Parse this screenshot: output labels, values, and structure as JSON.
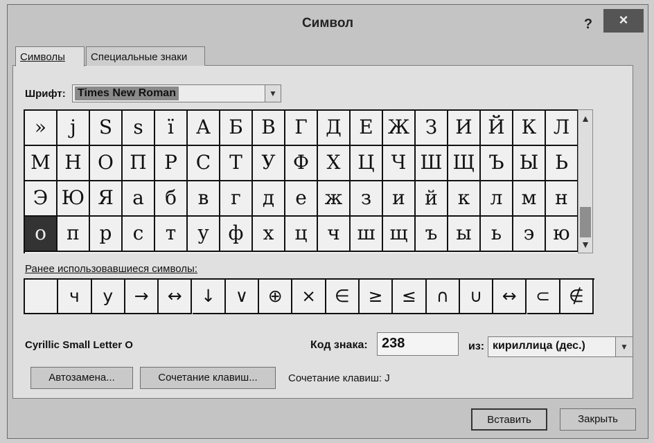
{
  "dialog": {
    "title": "Символ",
    "help_label": "?",
    "close_label": "×"
  },
  "tabs": [
    {
      "label": "Символы",
      "active": true
    },
    {
      "label": "Специальные знаки",
      "active": false
    }
  ],
  "font": {
    "label": "Шрифт:",
    "value": "Times New Roman"
  },
  "symbol_grid": {
    "rows": [
      [
        "»",
        "j",
        "S",
        "s",
        "ï",
        "А",
        "Б",
        "В",
        "Г",
        "Д",
        "Е",
        "Ж",
        "З",
        "И",
        "Й",
        "К",
        "Л"
      ],
      [
        "М",
        "Н",
        "О",
        "П",
        "Р",
        "С",
        "Т",
        "У",
        "Ф",
        "Х",
        "Ц",
        "Ч",
        "Ш",
        "Щ",
        "Ъ",
        "Ы",
        "Ь"
      ],
      [
        "Э",
        "Ю",
        "Я",
        "а",
        "б",
        "в",
        "г",
        "д",
        "е",
        "ж",
        "з",
        "и",
        "й",
        "к",
        "л",
        "м",
        "н"
      ],
      [
        "о",
        "п",
        "р",
        "с",
        "т",
        "у",
        "ф",
        "х",
        "ц",
        "ч",
        "ш",
        "щ",
        "ъ",
        "ы",
        "ь",
        "э",
        "ю"
      ]
    ],
    "selected_row": 3,
    "selected_col": 0
  },
  "recent": {
    "label": "Ранее использовавшиеся символы:",
    "symbols": [
      "",
      "ч",
      "у",
      "→",
      "↔",
      "↓",
      "∨",
      "⊕",
      "×",
      "∈",
      "≥",
      "≤",
      "∩",
      "∪",
      "↔",
      "⊂",
      "∉"
    ]
  },
  "char_name": "Cyrillic Small Letter O",
  "code": {
    "label": "Код знака:",
    "value": "238"
  },
  "from": {
    "label": "из:",
    "value": "кириллица (дес.)"
  },
  "buttons": {
    "autocorrect": "Автозамена...",
    "shortcut_key": "Сочетание клавиш...",
    "shortcut_text": "Сочетание клавиш: J",
    "insert": "Вставить",
    "close": "Закрыть"
  },
  "colors": {
    "selection": "#333333",
    "dialog_bg": "#c4c4c4"
  }
}
